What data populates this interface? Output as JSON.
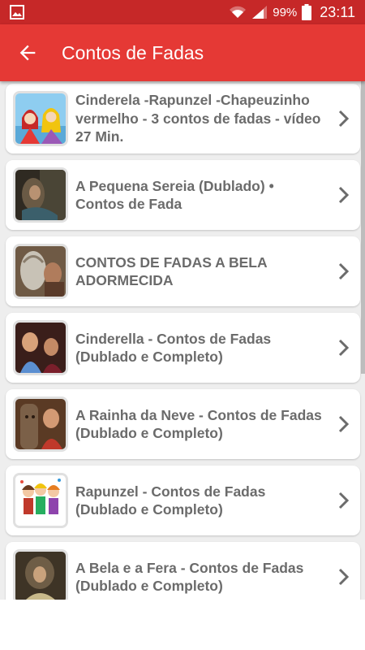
{
  "status_bar": {
    "battery_percent": "99%",
    "time": "23:11",
    "icons": [
      "image-notification-icon",
      "wifi-icon",
      "signal-icon",
      "battery-icon"
    ]
  },
  "app_bar": {
    "title": "Contos de Fadas",
    "back_icon": "arrow-left-icon"
  },
  "colors": {
    "app_bar": "#e53935",
    "status_bar": "#c62828",
    "list_background": "#eeeeee",
    "item_text": "#6b6b6b"
  },
  "videos": [
    {
      "title": "Cinderela -Rapunzel -Chapeuzinho vermelho - 3 contos de fadas - vídeo 27 Min.",
      "thumbnail": "cartoon-princesses-thumbnail"
    },
    {
      "title": "A Pequena Sereia (Dublado) • Contos de Fada",
      "thumbnail": "little-mermaid-thumbnail"
    },
    {
      "title": "CONTOS DE FADAS A BELA ADORMECIDA",
      "thumbnail": "sleeping-beauty-thumbnail"
    },
    {
      "title": "Cinderella - Contos de Fadas (Dublado e Completo)",
      "thumbnail": "cinderella-thumbnail"
    },
    {
      "title": "A Rainha da Neve - Contos de Fadas (Dublado e Completo)",
      "thumbnail": "snow-queen-thumbnail"
    },
    {
      "title": "Rapunzel - Contos de Fadas (Dublado e Completo)",
      "thumbnail": "cartoon-kids-thumbnail"
    },
    {
      "title": "A Bela e a Fera - Contos de Fadas (Dublado e Completo)",
      "thumbnail": "beauty-beast-thumbnail"
    }
  ]
}
